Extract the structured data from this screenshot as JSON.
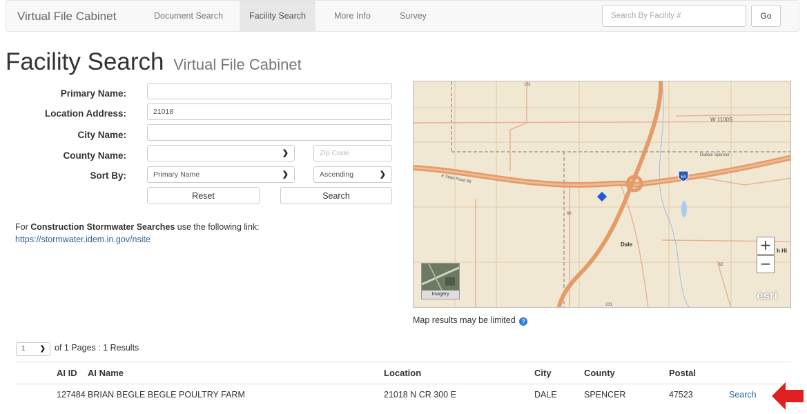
{
  "navbar": {
    "brand": "Virtual File Cabinet",
    "links": [
      "Document Search",
      "Facility Search",
      "More Info",
      "Survey"
    ],
    "active_link": "Facility Search",
    "search_placeholder": "Search By Facility #",
    "go_label": "Go"
  },
  "page": {
    "title": "Facility Search",
    "subtitle": "Virtual File Cabinet"
  },
  "form": {
    "primary_name_label": "Primary Name:",
    "primary_name_value": "",
    "location_address_label": "Location Address:",
    "location_address_value": "21018",
    "city_name_label": "City Name:",
    "city_name_value": "",
    "county_name_label": "County Name:",
    "county_name_value": "",
    "zip_placeholder": "Zip Code",
    "sort_by_label": "Sort By:",
    "sort_by_value": "Primary Name",
    "sort_order_value": "Ascending",
    "reset_label": "Reset",
    "search_label": "Search"
  },
  "note": {
    "prefix": "For ",
    "bold": "Construction Stormwater Searches",
    "suffix": " use the following link:",
    "link": "https://stormwater.idem.in.gov/nsite"
  },
  "map": {
    "labels": {
      "w1100s": "W 1100S",
      "dubois_spencer": "Dubois Spencer",
      "dale": "Dale",
      "route_161": "161",
      "route_68": "68",
      "route_62": "62",
      "route_231": "231",
      "interstate": "64",
      "sr68_road": "E State Road 68",
      "h_hi": "h Hi"
    },
    "zoom_in": "+",
    "zoom_out": "−",
    "imagery_label": "Imagery",
    "esri_logo": "esri",
    "caption": "Map results may be limited",
    "info_icon": "?"
  },
  "pager": {
    "page_value": "1",
    "text": "of 1 Pages : 1 Results"
  },
  "table": {
    "headers": [
      "AI ID",
      "AI Name",
      "Location",
      "City",
      "County",
      "Postal"
    ],
    "rows": [
      {
        "ai_id": "127484",
        "ai_name": "BRIAN BEGLE BEGLE POULTRY FARM",
        "location": "21018 N CR 300 E",
        "city": "DALE",
        "county": "SPENCER",
        "postal": "47523",
        "action": "Search"
      }
    ]
  },
  "colors": {
    "link": "#2a6496",
    "highway": "#e49b6a",
    "marker": "#1f5bd8",
    "arrow": "#e02020"
  }
}
